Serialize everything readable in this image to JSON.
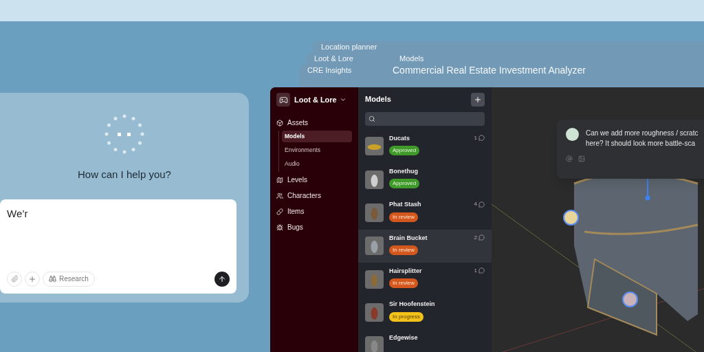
{
  "background_windows": [
    {
      "title": "Location planner"
    },
    {
      "title": "Loot & Lore",
      "panel_title": "Models"
    },
    {
      "title": "CRE Insights",
      "panel_title": "Commercial Real Estate Investment Analyzer"
    }
  ],
  "assistant": {
    "prompt": "How can I help you?",
    "input_value": "We’r",
    "research_label": "Research"
  },
  "app": {
    "workspace": "Loot & Lore",
    "nav": [
      {
        "label": "Assets",
        "children": [
          {
            "label": "Models",
            "selected": true
          },
          {
            "label": "Environments",
            "selected": false
          },
          {
            "label": "Audio",
            "selected": false
          }
        ]
      },
      {
        "label": "Levels"
      },
      {
        "label": "Characters"
      },
      {
        "label": "Items"
      },
      {
        "label": "Bugs"
      }
    ],
    "list_title": "Models",
    "models": [
      {
        "name": "Ducats",
        "status": "Approved",
        "kind": "approved",
        "comments": "1",
        "selected": false
      },
      {
        "name": "Bonethug",
        "status": "Approved",
        "kind": "approved",
        "selected": false
      },
      {
        "name": "Phat Stash",
        "status": "In review",
        "kind": "review",
        "comments": "4",
        "selected": false
      },
      {
        "name": "Brain Bucket",
        "status": "In review",
        "kind": "review",
        "comments": "2",
        "selected": true
      },
      {
        "name": "Hairsplitter",
        "status": "In review",
        "kind": "review",
        "comments": "1",
        "selected": false
      },
      {
        "name": "Sir Hoofenstein",
        "status": "In progress",
        "kind": "progress",
        "selected": false
      },
      {
        "name": "Edgewise",
        "selected": false
      }
    ],
    "comment": {
      "text": "Can we add more roughness / scratc here? It should look more battle-sca"
    }
  }
}
